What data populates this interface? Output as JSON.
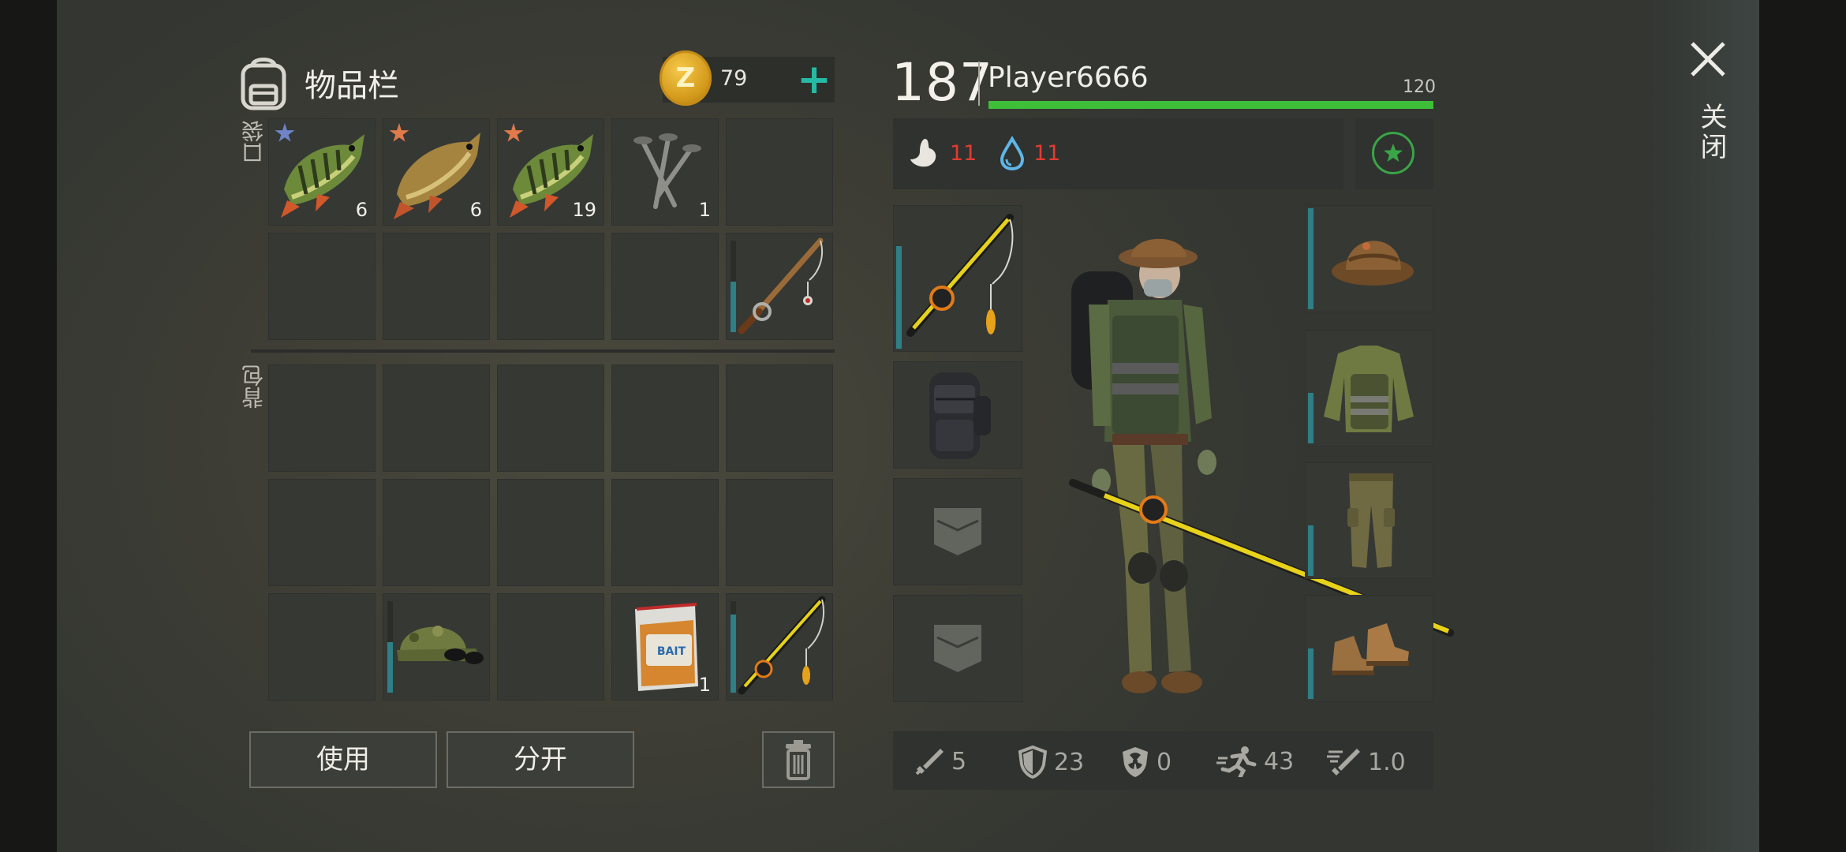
{
  "inventory": {
    "title": "物品栏",
    "pockets_label": "口袋",
    "backpack_label": "背包",
    "coins": "79",
    "coin_symbol": "Z",
    "pockets": [
      {
        "item": "perch",
        "qty": "6",
        "star": "#6f84c8"
      },
      {
        "item": "carp",
        "qty": "6",
        "star": "#e07a4b"
      },
      {
        "item": "perch",
        "qty": "19",
        "star": "#e07a4b"
      },
      {
        "item": "nails",
        "qty": "1"
      },
      {
        "item": "empty"
      },
      {
        "item": "empty"
      },
      {
        "item": "empty"
      },
      {
        "item": "empty"
      },
      {
        "item": "empty"
      },
      {
        "item": "fishing-rod-simple",
        "durability": 0.55
      }
    ],
    "backpack": [
      {
        "item": "empty"
      },
      {
        "item": "empty"
      },
      {
        "item": "empty"
      },
      {
        "item": "empty"
      },
      {
        "item": "empty"
      },
      {
        "item": "empty"
      },
      {
        "item": "empty"
      },
      {
        "item": "empty"
      },
      {
        "item": "empty"
      },
      {
        "item": "empty"
      },
      {
        "item": "empty"
      },
      {
        "item": "camo-cap-sunglasses",
        "durability": 0.55
      },
      {
        "item": "empty"
      },
      {
        "item": "bait-bag",
        "qty": "1",
        "bag_label": "BAIT"
      },
      {
        "item": "fishing-rod-yellow",
        "durability": 0.85
      }
    ],
    "buttons": {
      "use": "使用",
      "split": "分开"
    }
  },
  "character": {
    "level": "187",
    "name": "Player6666",
    "xp_max": "120",
    "xp_fraction": 1.0,
    "hunger": "11",
    "thirst": "11",
    "equipment_left": [
      {
        "slot": "weapon",
        "item": "fishing-rod-yellow",
        "durability": 0.7
      },
      {
        "slot": "backpack",
        "item": "backpack"
      },
      {
        "slot": "pocket",
        "item": "empty-pocket"
      },
      {
        "slot": "pocket",
        "item": "empty-pocket"
      }
    ],
    "equipment_right": [
      {
        "slot": "head",
        "item": "bucket-hat",
        "durability": 0.95
      },
      {
        "slot": "body",
        "item": "camo-vest",
        "durability": 0.45
      },
      {
        "slot": "legs",
        "item": "camo-pants",
        "durability": 0.45
      },
      {
        "slot": "feet",
        "item": "boots",
        "durability": 0.45
      }
    ],
    "stats": {
      "damage": "5",
      "armor": "23",
      "radiation": "0",
      "speed": "43",
      "attack_speed": "1.0"
    }
  },
  "close": {
    "label": "关闭"
  },
  "colors": {
    "accent_teal": "#26b9a4",
    "xp_green": "#3fbe3a",
    "hunger_red": "#e23b33",
    "water_blue": "#5fb6e8",
    "durability": "#2e7f86"
  }
}
